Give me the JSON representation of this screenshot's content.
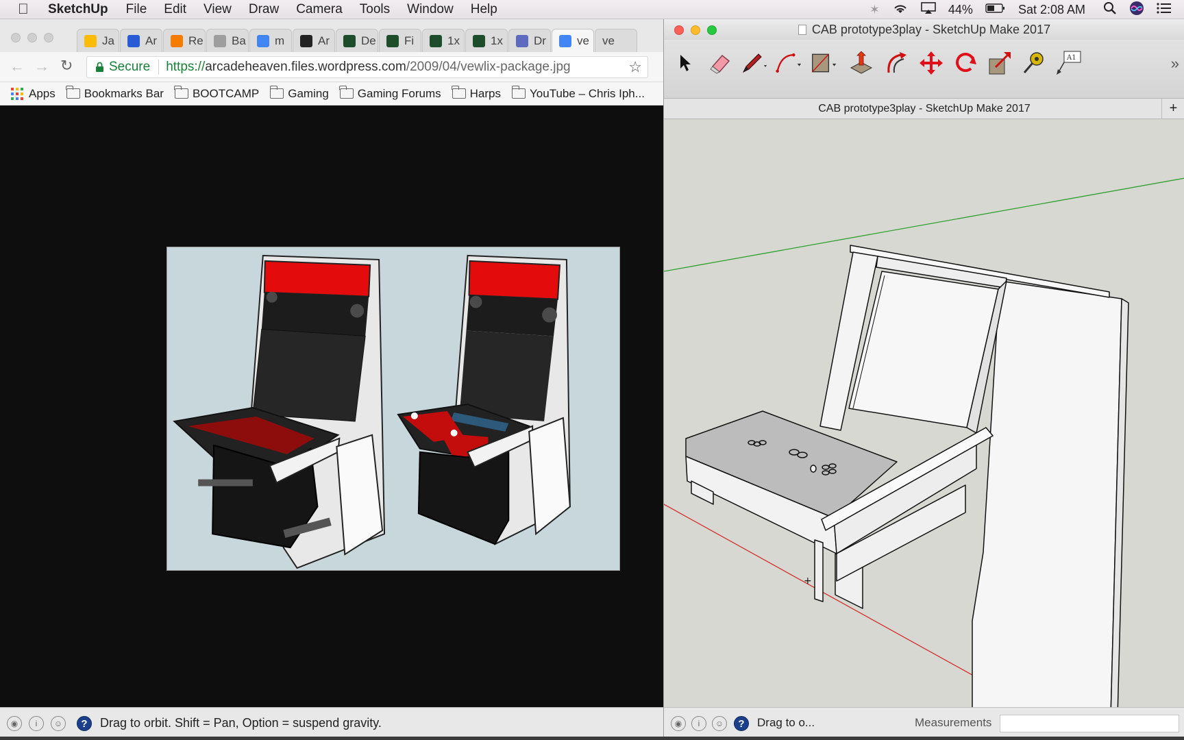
{
  "menubar": {
    "app_name": "SketchUp",
    "items": [
      "File",
      "Edit",
      "View",
      "Draw",
      "Camera",
      "Tools",
      "Window",
      "Help"
    ],
    "battery": "44%",
    "clock": "Sat 2:08 AM"
  },
  "browser": {
    "tabs": [
      {
        "label": "Ja",
        "icon": "google-drive-icon",
        "color": "#fbbc05"
      },
      {
        "label": "Ar",
        "icon": "ap-logo-icon",
        "color": "#2a5bd7"
      },
      {
        "label": "Re",
        "icon": "blogger-icon",
        "color": "#f57c00"
      },
      {
        "label": "Ba",
        "icon": "joystick-icon",
        "color": "#9e9e9e"
      },
      {
        "label": "m",
        "icon": "google-icon",
        "color": "#4285f4"
      },
      {
        "label": "Ar",
        "icon": "amazon-icon",
        "color": "#222222"
      },
      {
        "label": "De",
        "icon": "ashby-icon",
        "color": "#1e4d2b"
      },
      {
        "label": "Fi",
        "icon": "ashby-icon",
        "color": "#1e4d2b"
      },
      {
        "label": "1x",
        "icon": "ashby-icon",
        "color": "#1e4d2b"
      },
      {
        "label": "1x",
        "icon": "ashby-icon",
        "color": "#1e4d2b"
      },
      {
        "label": "Dr",
        "icon": "g-logo-icon",
        "color": "#5c6bc0"
      },
      {
        "label": "ve",
        "icon": "google-icon",
        "color": "#4285f4"
      },
      {
        "label": "ve",
        "icon": "none",
        "color": "#ffffff"
      }
    ],
    "secure_label": "Secure",
    "url_prefix": "https://",
    "url_host": "arcadeheaven.files.wordpress.com",
    "url_path": "/2009/04/vewlix-package.jpg",
    "bookmarks": [
      "Apps",
      "Bookmarks Bar",
      "BOOTCAMP",
      "Gaming",
      "Gaming Forums",
      "Harps",
      "YouTube – Chris Iph..."
    ]
  },
  "sketchup": {
    "window_title": "CAB prototype3play - SketchUp Make 2017",
    "tab_title": "CAB prototype3play - SketchUp Make 2017",
    "tools": [
      "select-tool-icon",
      "eraser-tool-icon",
      "pencil-tool-icon",
      "arc-tool-icon",
      "rectangle-tool-icon",
      "push-pull-tool-icon",
      "offset-tool-icon",
      "move-tool-icon",
      "rotate-tool-icon",
      "scale-tool-icon",
      "tape-measure-tool-icon",
      "text-tool-icon"
    ],
    "status_text": "Drag to o...",
    "measurements_label": "Measurements",
    "measurements_value": ""
  },
  "status_main": "Drag to orbit. Shift = Pan, Option = suspend gravity.",
  "colors": {
    "accent_red": "#e30b0b",
    "secure_green": "#188038",
    "help_blue": "#1b3f8b"
  }
}
